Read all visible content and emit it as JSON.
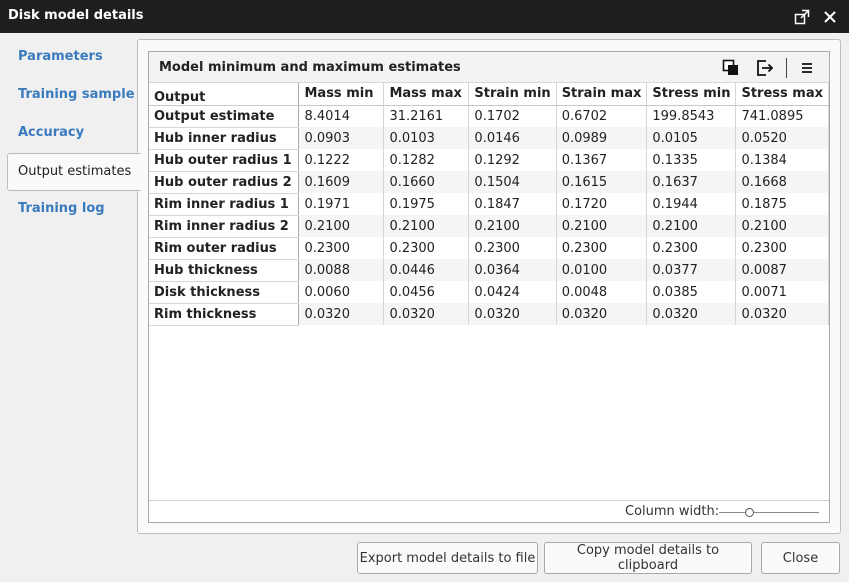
{
  "window": {
    "title": "Disk model details"
  },
  "sidebar": {
    "items": [
      {
        "label": "Parameters"
      },
      {
        "label": "Training sample"
      },
      {
        "label": "Accuracy"
      },
      {
        "label": "Output estimates",
        "active": true
      },
      {
        "label": "Training log"
      }
    ]
  },
  "panel": {
    "title": "Model minimum and maximum estimates",
    "icons": [
      "copy-icon",
      "export-icon",
      "menu-icon"
    ],
    "table": {
      "row_header_label": "Output",
      "columns": [
        "Mass min",
        "Mass max",
        "Strain min",
        "Strain max",
        "Stress min",
        "Stress max"
      ],
      "rows": [
        {
          "name": "Output estimate",
          "values": [
            "8.4014",
            "31.2161",
            "0.1702",
            "0.6702",
            "199.8543",
            "741.0895"
          ]
        },
        {
          "name": "Hub inner radius",
          "values": [
            "0.0903",
            "0.0103",
            "0.0146",
            "0.0989",
            "0.0105",
            "0.0520"
          ]
        },
        {
          "name": "Hub outer radius 1",
          "values": [
            "0.1222",
            "0.1282",
            "0.1292",
            "0.1367",
            "0.1335",
            "0.1384"
          ]
        },
        {
          "name": "Hub outer radius 2",
          "values": [
            "0.1609",
            "0.1660",
            "0.1504",
            "0.1615",
            "0.1637",
            "0.1668"
          ]
        },
        {
          "name": "Rim inner radius 1",
          "values": [
            "0.1971",
            "0.1975",
            "0.1847",
            "0.1720",
            "0.1944",
            "0.1875"
          ]
        },
        {
          "name": "Rim inner radius 2",
          "values": [
            "0.2100",
            "0.2100",
            "0.2100",
            "0.2100",
            "0.2100",
            "0.2100"
          ]
        },
        {
          "name": "Rim outer radius",
          "values": [
            "0.2300",
            "0.2300",
            "0.2300",
            "0.2300",
            "0.2300",
            "0.2300"
          ]
        },
        {
          "name": "Hub thickness",
          "values": [
            "0.0088",
            "0.0446",
            "0.0364",
            "0.0100",
            "0.0377",
            "0.0087"
          ]
        },
        {
          "name": "Disk thickness",
          "values": [
            "0.0060",
            "0.0456",
            "0.0424",
            "0.0048",
            "0.0385",
            "0.0071"
          ]
        },
        {
          "name": "Rim thickness",
          "values": [
            "0.0320",
            "0.0320",
            "0.0320",
            "0.0320",
            "0.0320",
            "0.0320"
          ]
        }
      ]
    },
    "footer": {
      "column_width_label": "Column width:"
    }
  },
  "buttons": {
    "export": "Export model details to file",
    "copy": "Copy model details to clipboard",
    "close": "Close"
  },
  "colors": {
    "titlebar": "#1e1e1e",
    "link": "#3a7bbf"
  }
}
